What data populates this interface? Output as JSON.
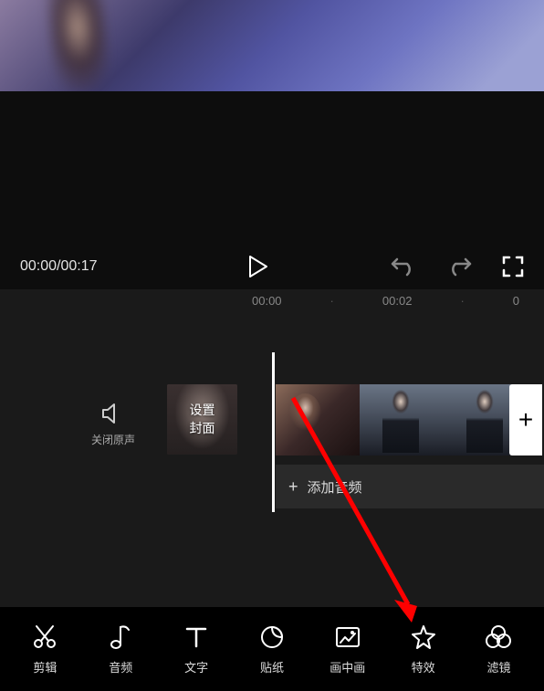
{
  "playback": {
    "time_display": "00:00/00:17"
  },
  "ruler": {
    "marks": [
      "00:00",
      "·",
      "00:02",
      "·",
      "0"
    ]
  },
  "timeline": {
    "mute_label": "关闭原声",
    "cover_line1": "设置",
    "cover_line2": "封面",
    "add_clip": "+",
    "add_audio_plus": "+",
    "add_audio_label": "添加音频"
  },
  "toolbar": {
    "items": [
      {
        "label": "剪辑",
        "icon": "scissors"
      },
      {
        "label": "音频",
        "icon": "note"
      },
      {
        "label": "文字",
        "icon": "text"
      },
      {
        "label": "贴纸",
        "icon": "sticker"
      },
      {
        "label": "画中画",
        "icon": "pip"
      },
      {
        "label": "特效",
        "icon": "star"
      },
      {
        "label": "滤镜",
        "icon": "filter"
      }
    ]
  }
}
